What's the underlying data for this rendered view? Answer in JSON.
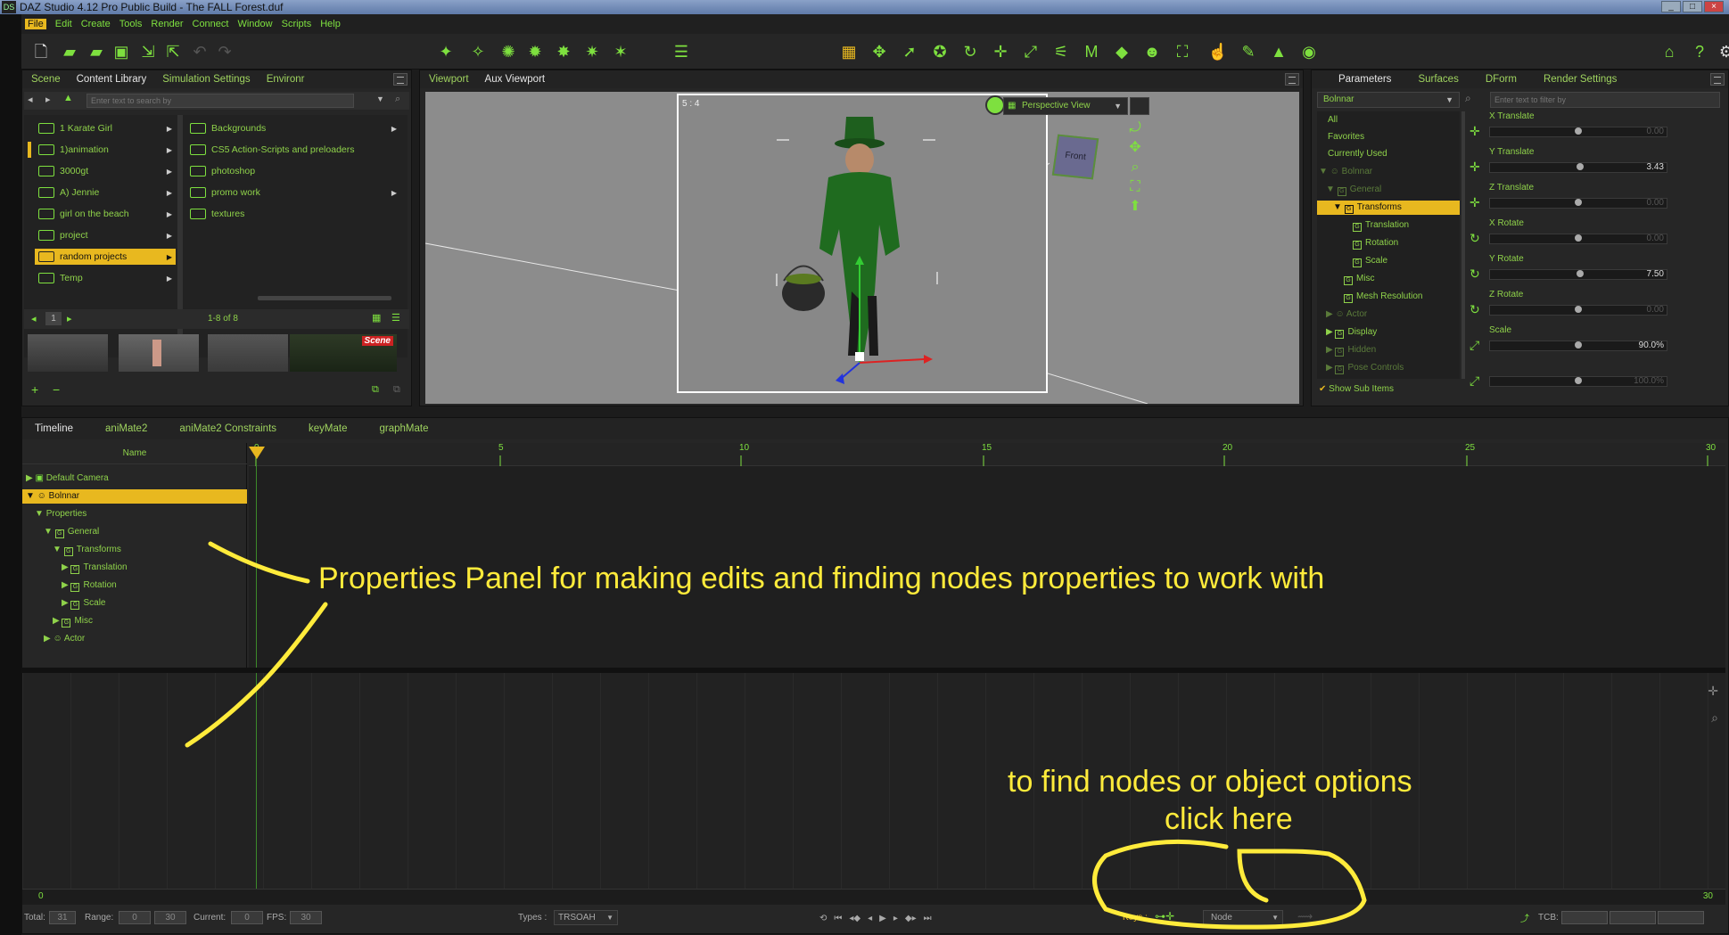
{
  "window": {
    "title": "DAZ Studio 4.12 Pro Public Build - The FALL Forest.duf",
    "logo": "DS"
  },
  "menu": [
    "File",
    "Edit",
    "Create",
    "Tools",
    "Render",
    "Connect",
    "Window",
    "Scripts",
    "Help"
  ],
  "left_tabs": [
    "Scene",
    "Content Library",
    "Simulation Settings",
    "Environr"
  ],
  "search_placeholder": "Enter text to search by",
  "folders_left": [
    "1 Karate Girl",
    "1)animation",
    "3000gt",
    "A) Jennie",
    "girl on the beach",
    "project",
    "random projects",
    "Temp"
  ],
  "folders_right": [
    "Backgrounds",
    "CS5 Action-Scripts and preloaders",
    "photoshop",
    "promo work",
    "textures"
  ],
  "pager": {
    "page": "1",
    "count": "1-8 of 8"
  },
  "thumb_badge": "Scene",
  "viewport_tabs": [
    "Viewport",
    "Aux Viewport"
  ],
  "viewport": {
    "aspect": "5 : 4",
    "view_mode": "Perspective View",
    "cube_label": "Front"
  },
  "right_tabs": [
    "Parameters",
    "Surfaces",
    "DForm",
    "Render Settings"
  ],
  "node_select": "Bolnnar",
  "filter_placeholder": "Enter text to filter by",
  "param_tree": [
    "All",
    "Favorites",
    "Currently Used",
    "Bolnnar",
    "General",
    "Transforms",
    "Translation",
    "Rotation",
    "Scale",
    "Misc",
    "Mesh Resolution",
    "Actor",
    "Display",
    "Hidden",
    "Pose Controls"
  ],
  "show_sub_items": "Show Sub Items",
  "sliders": [
    {
      "label": "X Translate",
      "value": "0.00",
      "pos": 0.5
    },
    {
      "label": "Y Translate",
      "value": "3.43",
      "pos": 0.51
    },
    {
      "label": "Z Translate",
      "value": "0.00",
      "pos": 0.5
    },
    {
      "label": "X Rotate",
      "value": "0.00",
      "pos": 0.5
    },
    {
      "label": "Y Rotate",
      "value": "7.50",
      "pos": 0.51
    },
    {
      "label": "Z Rotate",
      "value": "0.00",
      "pos": 0.5
    },
    {
      "label": "Scale",
      "value": "90.0%",
      "pos": 0.5
    },
    {
      "label": "",
      "value": "100.0%",
      "pos": 0.5
    }
  ],
  "timeline_tabs": [
    "Timeline",
    "aniMate2",
    "aniMate2 Constraints",
    "keyMate",
    "graphMate"
  ],
  "name_header": "Name",
  "timeline_tree": [
    "Default Camera",
    "Bolnnar",
    "Properties",
    "General",
    "Transforms",
    "Translation",
    "Rotation",
    "Scale",
    "Misc",
    "Actor"
  ],
  "ruler": [
    "0",
    "5",
    "10",
    "15",
    "20",
    "25",
    "30"
  ],
  "bottom": {
    "start": "0",
    "end": "30",
    "total_label": "Total:",
    "total": "31",
    "range_label": "Range:",
    "range_a": "0",
    "range_b": "30",
    "current_label": "Current:",
    "current": "0",
    "fps_label": "FPS:",
    "fps": "30",
    "types_label": "Types :",
    "types": "TRSOAH",
    "keys_label": "Keys :",
    "keys_mode": "Node",
    "tcb_label": "TCB:"
  },
  "annotations": {
    "properties": "Properties Panel for making edits and finding nodes properties to work with",
    "nodes_line1": "to find nodes or object options",
    "nodes_line2": "click here"
  },
  "colors": {
    "accent": "#7ee03f",
    "highlight": "#e8b81f",
    "annotation": "#ffeb3b"
  }
}
